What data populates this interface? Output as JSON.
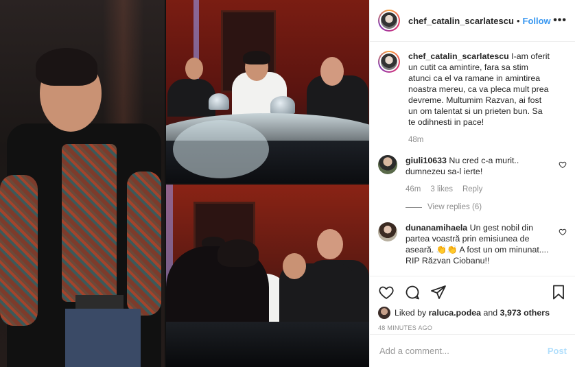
{
  "post": {
    "author": "chef_catalin_scarlatescu",
    "dot": "•",
    "follow_label": "Follow",
    "more_label": "•••",
    "caption": {
      "username": "chef_catalin_scarlatescu",
      "text": "I-am oferit un cutit ca amintire, fara sa stim atunci ca el va ramane in amintirea noastra mereu, ca va pleca mult prea devreme. Multumim Razvan, ai fost un om talentat si un prieten bun. Sa te odihnesti in pace!",
      "time": "48m"
    },
    "comments": [
      {
        "username": "giuli10633",
        "text": "Nu cred c-a murit.. dumnezeu sa-l ierte!",
        "time": "46m",
        "likes": "3 likes",
        "reply_label": "Reply",
        "view_replies": "View replies (6)"
      },
      {
        "username": "dunanamihaela",
        "text": "Un gest nobil din partea voastră prin emisiunea de aseară. 👏👏 A fost un om minunat.... RIP Răzvan Ciobanu!!"
      }
    ],
    "likes": {
      "liked_by_prefix": "Liked by",
      "liked_by_user": "raluca.podea",
      "and_label": "and",
      "others": "3,973 others"
    },
    "timestamp": "48 MINUTES AGO",
    "add_comment_placeholder": "Add a comment...",
    "post_label": "Post"
  },
  "icons": {
    "like": "heart-icon",
    "comment": "comment-icon",
    "share": "share-icon",
    "save": "bookmark-icon"
  },
  "colors": {
    "accent": "#3897f0",
    "post_disabled": "#b2dffc",
    "muted": "#8e8e8e"
  }
}
